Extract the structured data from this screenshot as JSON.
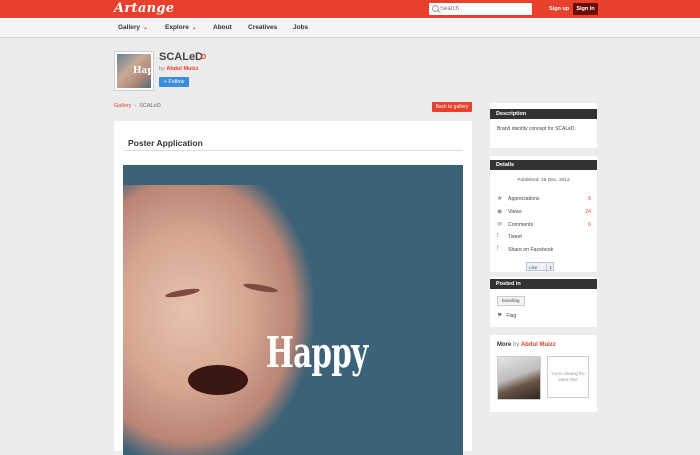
{
  "brand": {
    "logo": "Artange"
  },
  "header": {
    "search_placeholder": "Search",
    "signup": "Sign up",
    "signin": "Sign in"
  },
  "nav": {
    "items": [
      {
        "label": "Gallery",
        "dropdown": true
      },
      {
        "label": "Explore",
        "dropdown": true
      },
      {
        "label": "About",
        "dropdown": false
      },
      {
        "label": "Creatives",
        "dropdown": false
      },
      {
        "label": "Jobs",
        "dropdown": false
      }
    ]
  },
  "project": {
    "thumb_text": "Happ",
    "title": "SCALeD",
    "by": "by",
    "author": "Abdul Muizz",
    "follow": "+  Follow"
  },
  "breadcrumb": {
    "root": "Gallery",
    "sep": "›",
    "current": "SCALeD",
    "back": "Back to gallery"
  },
  "main": {
    "title": "Poster Application",
    "poster_text": "Happy"
  },
  "sidebar": {
    "description": {
      "title": "Description",
      "text": "Brand identity concept for SCALeD."
    },
    "details": {
      "title": "Details",
      "published": "Published: 25 Dec, 2012",
      "rows": [
        {
          "label": "Appreciations",
          "value": "6",
          "icon": "star-icon"
        },
        {
          "label": "Views",
          "value": "24",
          "icon": "eye-icon"
        },
        {
          "label": "Comments",
          "value": "6",
          "icon": "comment-icon"
        },
        {
          "label": "Tweet",
          "value": "",
          "icon": "twitter-icon"
        },
        {
          "label": "Share on Facebook",
          "value": "",
          "icon": "facebook-icon"
        }
      ],
      "like_label": "Like",
      "like_count": "1"
    },
    "posted": {
      "title": "Posted in",
      "tag": "branding",
      "flag": "Flag"
    },
    "more": {
      "prefix": "More",
      "by": "by",
      "author": "Abdul Muizz",
      "viewing_text": "You're viewing the latest shot"
    }
  },
  "colors": {
    "accent": "#e8402c",
    "dark": "#333333",
    "button_blue": "#3b8edb"
  }
}
